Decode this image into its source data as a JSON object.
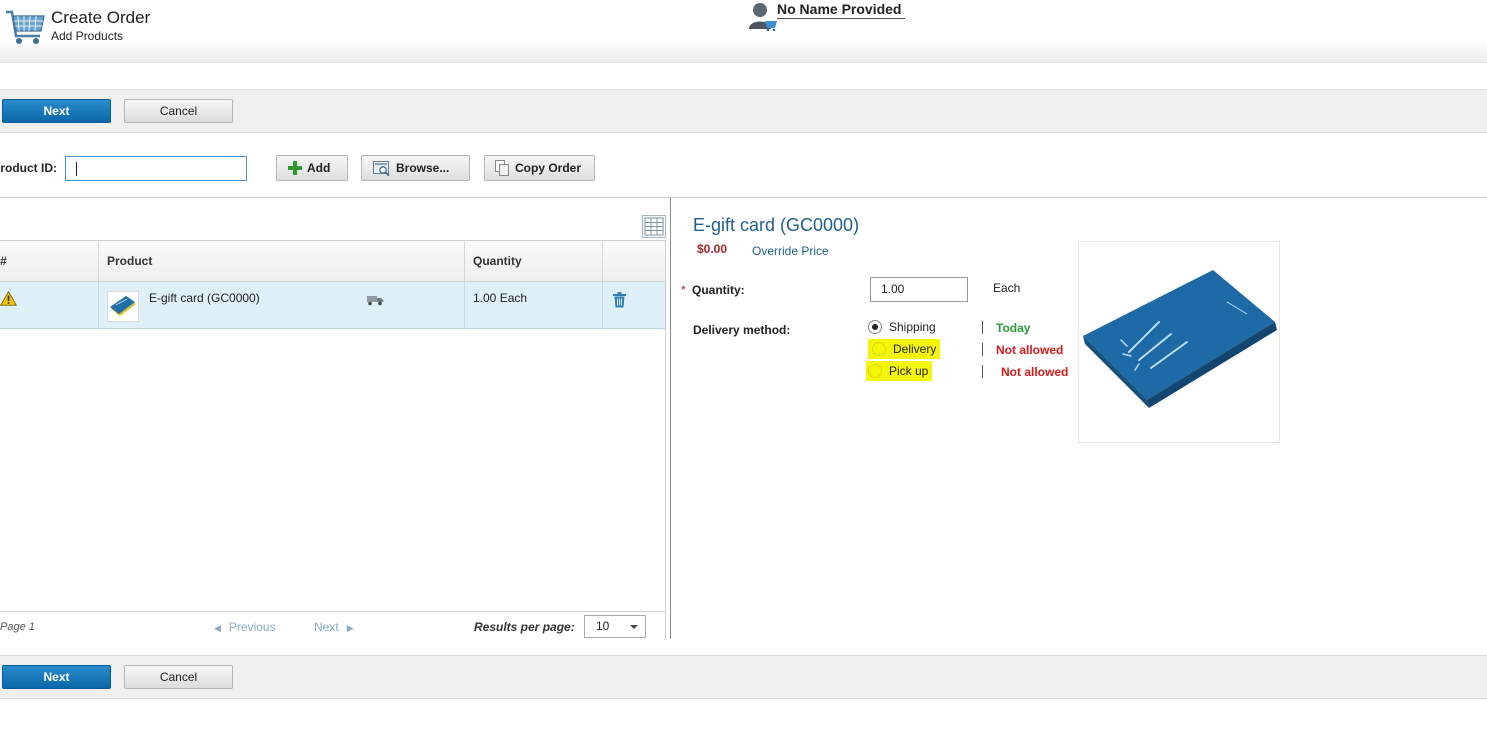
{
  "header": {
    "title": "Create Order",
    "subtitle": "Add Products",
    "customer_name": "No Name Provided"
  },
  "actions": {
    "next_label": "Next",
    "cancel_label": "Cancel"
  },
  "toolbar": {
    "product_id_label": "Product ID:",
    "product_id_value": "",
    "add_label": "Add",
    "browse_label": "Browse...",
    "copy_order_label": "Copy Order"
  },
  "grid": {
    "columns": [
      "#",
      "Product",
      "Quantity"
    ],
    "rows": [
      {
        "product": "E-gift card (GC0000)",
        "quantity": "1.00 Each",
        "has_warning": true
      }
    ],
    "footer": {
      "page_label": "Page 1",
      "previous_label": "Previous",
      "next_label": "Next",
      "results_per_page_label": "Results per page:",
      "results_per_page_value": "10"
    }
  },
  "detail": {
    "title": "E-gift card (GC0000)",
    "price": "$0.00",
    "override_price_label": "Override Price",
    "required_marker": "*",
    "quantity_label": "Quantity:",
    "quantity_value": "1.00",
    "quantity_unit": "Each",
    "delivery_method_label": "Delivery method:",
    "methods": [
      {
        "label": "Shipping",
        "availability": "Today",
        "selected": true
      },
      {
        "label": "Delivery",
        "availability": "Not allowed",
        "selected": false
      },
      {
        "label": "Pick up",
        "availability": "Not allowed",
        "selected": false
      }
    ]
  },
  "colors": {
    "primary_button": "#0a67a8",
    "link": "#1f5f8f",
    "price": "#a3242a",
    "available": "#2a9a3a",
    "not_allowed": "#d81a1a",
    "highlight": "#f5f50a",
    "selected_row": "#dff0f8"
  }
}
